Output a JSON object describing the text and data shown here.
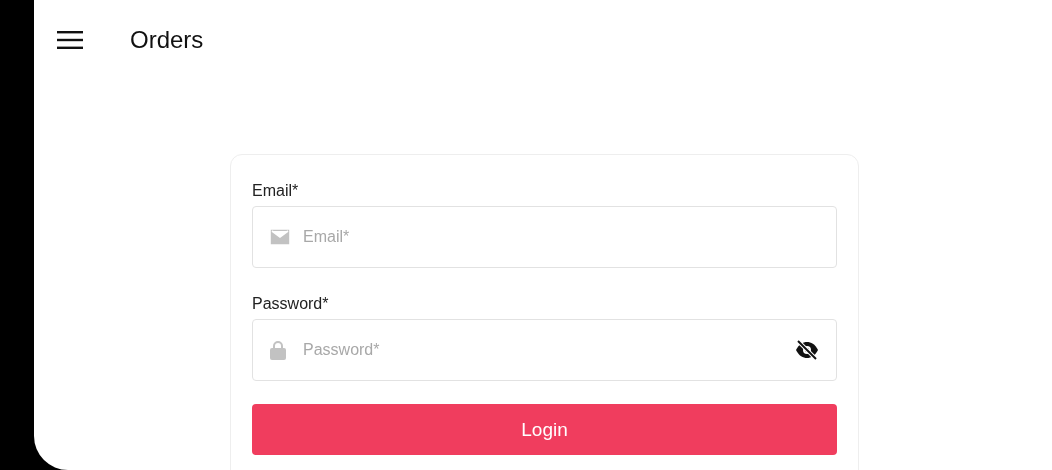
{
  "app_bar": {
    "title": "Orders"
  },
  "login_form": {
    "fields": [
      {
        "kind": "email",
        "label": "Email*",
        "placeholder": "Email*"
      },
      {
        "kind": "password",
        "label": "Password*",
        "placeholder": "Password*",
        "password_visible": false
      }
    ],
    "submit_button": "Login"
  }
}
